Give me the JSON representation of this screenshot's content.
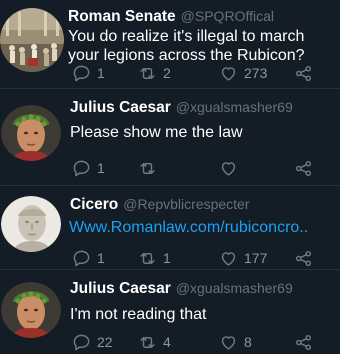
{
  "tweets": [
    {
      "name": "Roman Senate",
      "handle": "@SPQROffical",
      "text": "You do realize it's illegal to march your legions across the Rubicon?",
      "replies": "1",
      "retweets": "2",
      "likes": "273",
      "avatar": "senate-painting-avatar"
    },
    {
      "name": "Julius Caesar",
      "handle": "@xgualsmasher69",
      "text": "Please show me the law",
      "replies": "1",
      "retweets": "",
      "likes": "",
      "avatar": "caesar-bust-avatar"
    },
    {
      "name": "Cicero",
      "handle": "@Repvblicrespecter",
      "text": "Www.Romanlaw.com/rubiconcro..",
      "replies": "1",
      "retweets": "1",
      "likes": "177",
      "avatar": "cicero-bust-avatar"
    },
    {
      "name": "Julius Caesar",
      "handle": "@xgualsmasher69",
      "text": "I'm not reading that",
      "replies": "22",
      "retweets": "4",
      "likes": "8",
      "avatar": "caesar-bust-avatar"
    }
  ],
  "colors": {
    "background": "#141c26",
    "link": "#1da1f2",
    "muted": "#6f7b87"
  }
}
